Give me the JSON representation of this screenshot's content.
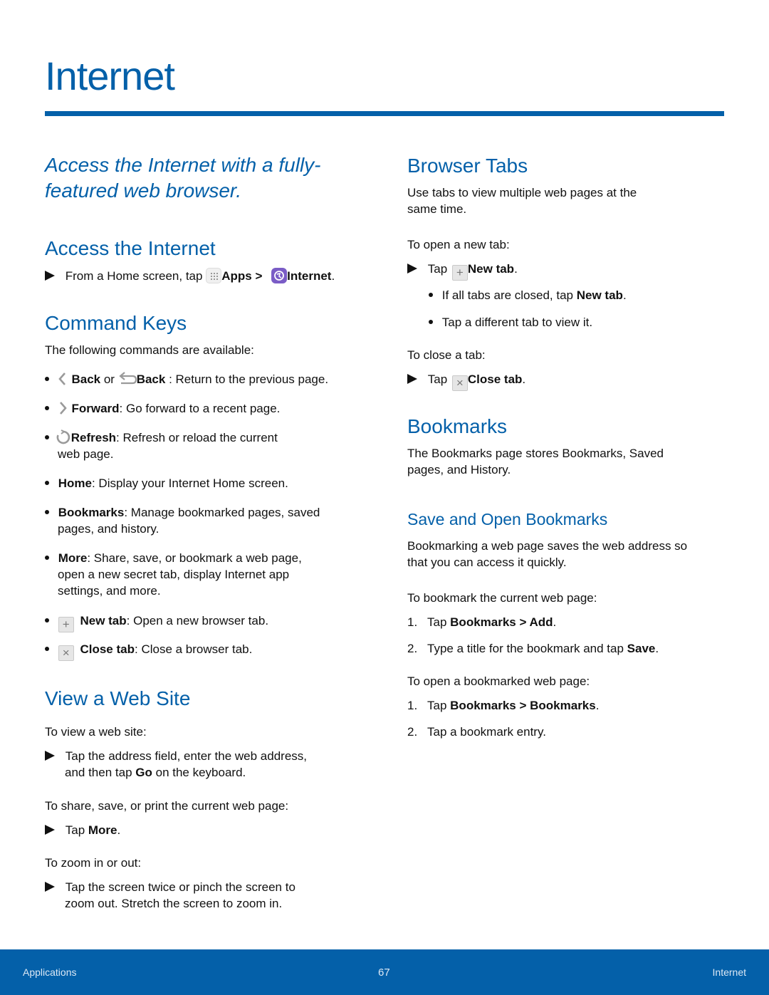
{
  "page": {
    "title": "Internet",
    "tagline": "Access the Internet with a fully-featured web browser.",
    "accent_color": "#0460a9"
  },
  "left": {
    "access": {
      "heading": "Access the Internet",
      "step_prefix": "From a Home screen, tap",
      "apps_label": "Apps",
      "separator": ">",
      "internet_label": "Internet",
      "step_suffix": "."
    },
    "command_keys": {
      "heading": "Command Keys",
      "intro": "The following commands are available:",
      "items": [
        {
          "icon": "chevron-left-icon",
          "label": "Back",
          "connector": "or",
          "icon2": "back-arrow-icon",
          "label2": "Back",
          "text": " : Return to the previous page."
        },
        {
          "icon": "chevron-right-icon",
          "label": "Forward",
          "text": ": Go forward to a recent page."
        },
        {
          "icon": "refresh-icon",
          "label": "Refresh",
          "text": ": Refresh or reload the current",
          "text2": "web page."
        },
        {
          "label": "Home",
          "text": ": Display your Internet Home screen."
        },
        {
          "label": "Bookmarks",
          "text": ": Manage bookmarked pages, saved",
          "text2": "pages, and history."
        },
        {
          "label": "More",
          "text": ": Share, save, or bookmark a web page,",
          "text2": "open a new secret tab, display Internet app",
          "text3": "settings, and more."
        },
        {
          "icon": "plus-icon",
          "label": "New tab",
          "text": ": Open a new browser tab."
        },
        {
          "icon": "close-icon",
          "label": "Close tab",
          "text": ": Close a browser tab."
        }
      ]
    },
    "view_site": {
      "heading": "View a Web Site",
      "intro1": "To view a web site:",
      "step1_line1": "Tap the address field, enter the web address,",
      "step1_line2_pre": "and then tap",
      "step1_bold": "Go",
      "step1_line2_post": "on the keyboard.",
      "intro2": "To share, save, or print the current web page:",
      "step2_pre": "Tap",
      "step2_bold": "More",
      "step2_post": ".",
      "intro3": "To zoom in or out:",
      "step3_line1": "Tap the screen twice or pinch the screen to",
      "step3_line2": "zoom out. Stretch the screen to zoom in."
    }
  },
  "right": {
    "browser_tabs": {
      "heading": "Browser Tabs",
      "desc_line1": "Use tabs to view multiple web pages at the",
      "desc_line2": "same time.",
      "open_intro": "To open a new tab:",
      "open_step_pre": "Tap",
      "open_step_bold": "New tab",
      "open_step_post": ".",
      "sub1_pre": "If all tabs are closed, tap",
      "sub1_bold": "New tab",
      "sub1_post": ".",
      "sub2": "Tap a different tab to view it.",
      "close_intro": "To close a tab:",
      "close_step_pre": "Tap",
      "close_step_bold": "Close tab",
      "close_step_post": "."
    },
    "bookmarks": {
      "heading": "Bookmarks",
      "desc_line1": "The Bookmarks page stores Bookmarks, Saved",
      "desc_line2": "pages, and History.",
      "subheading": "Save and Open Bookmarks",
      "sub_desc_line1": "Bookmarking a web page saves the web address so",
      "sub_desc_line2": "that you can access it quickly.",
      "save_intro": "To bookmark the current web page:",
      "save_steps": [
        {
          "num": "1.",
          "pre": "Tap",
          "bold": "Bookmarks > Add",
          "post": "."
        },
        {
          "num": "2.",
          "pre": "Type a title for the bookmark and tap",
          "bold": "Save",
          "post": "."
        }
      ],
      "open_intro": "To open a bookmarked web page:",
      "open_steps": [
        {
          "num": "1.",
          "pre": "Tap",
          "bold": "Bookmarks > Bookmarks",
          "post": "."
        },
        {
          "num": "2.",
          "pre": "Tap a bookmark entry.",
          "bold": "",
          "post": ""
        }
      ]
    }
  },
  "footer": {
    "left": "Applications",
    "page_number": "67",
    "right": "Internet"
  }
}
